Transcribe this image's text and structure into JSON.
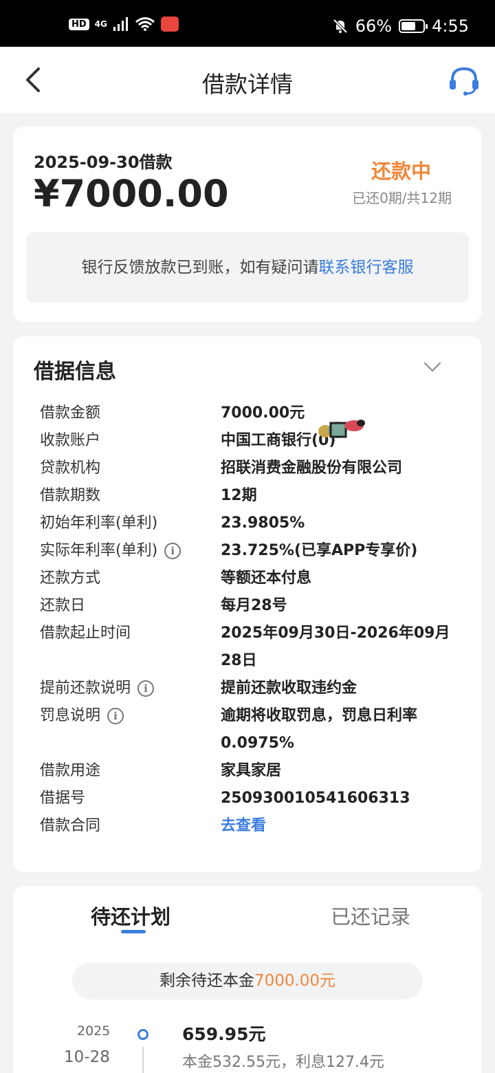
{
  "status_bar": {
    "hd": "HD",
    "network": "4G",
    "battery": "66%",
    "battery_level": 0.66,
    "time": "4:55"
  },
  "nav": {
    "title": "借款详情",
    "back_icon": "chevron-left-icon",
    "service_icon": "headset-icon"
  },
  "summary": {
    "loan_date": "2025-09-30借款",
    "amount": "¥7000.00",
    "status": "还款中",
    "progress": "已还0期/共12期",
    "notice_text": "银行反馈放款已到账，如有疑问请",
    "notice_link": "联系银行客服"
  },
  "receipt": {
    "title": "借据信息",
    "rows": [
      {
        "label": "借款金额",
        "value": "7000.00元"
      },
      {
        "label": "收款账户",
        "value": "中国工商银行(0)"
      },
      {
        "label": "贷款机构",
        "value": "招联消费金融股份有限公司"
      },
      {
        "label": "借款期数",
        "value": "12期"
      },
      {
        "label": "初始年利率(单利)",
        "value": "23.9805%"
      },
      {
        "label": "实际年利率(单利)",
        "value": "23.725%(已享APP专享价)"
      },
      {
        "label": "还款方式",
        "value": "等额还本付息"
      },
      {
        "label": "还款日",
        "value": "每月28号"
      },
      {
        "label": "借款起止时间",
        "value": "2025年09月30日-2026年09月28日"
      },
      {
        "label": "提前还款说明",
        "value": "提前还款收取违约金"
      },
      {
        "label": "罚息说明",
        "value": "逾期将收取罚息，罚息日利率0.0975%"
      },
      {
        "label": "借款用途",
        "value": "家具家居"
      },
      {
        "label": "借据号",
        "value": "250930010541606313"
      },
      {
        "label": "借款合同",
        "value": "去查看"
      }
    ]
  },
  "plan": {
    "tabs": [
      "待还计划",
      "已还记录"
    ],
    "remaining_label": "剩余待还本金",
    "remaining_value": "7000.00元",
    "items": [
      {
        "year": "2025",
        "date": "10-28",
        "amount": "659.95元",
        "detail": "本金532.55元，利息127.4元"
      }
    ]
  },
  "colors": {
    "accent": "#3a7ce0",
    "status_orange": "#f0873a",
    "background": "#f2f3f5"
  }
}
